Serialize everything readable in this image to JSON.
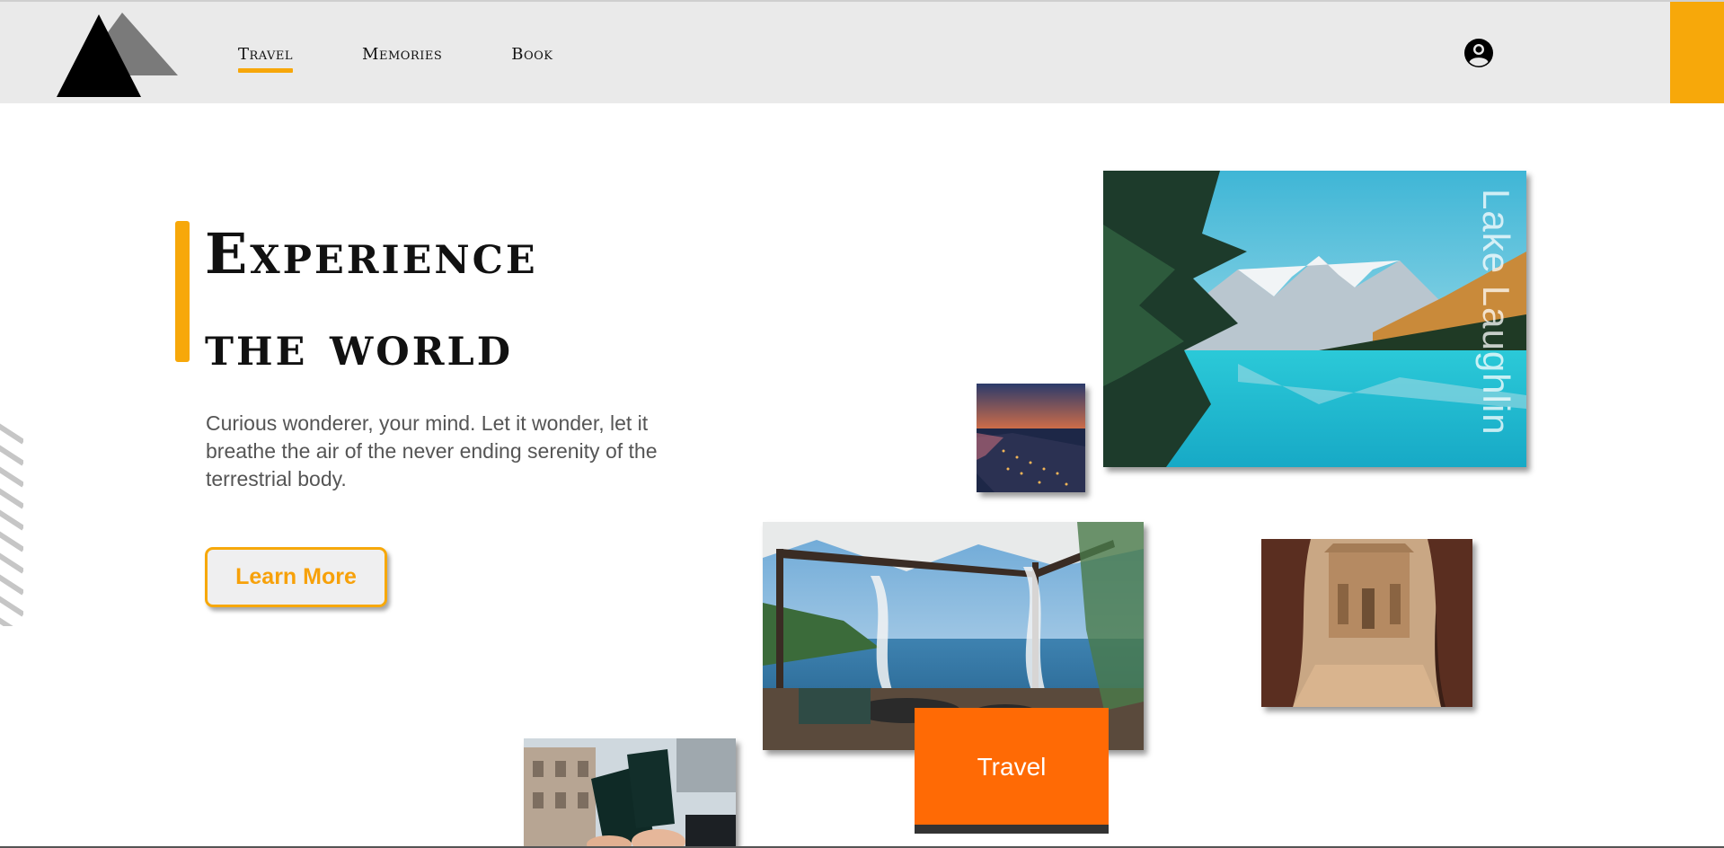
{
  "nav": {
    "items": [
      {
        "label": "Travel",
        "active": true
      },
      {
        "label": "Memories",
        "active": false
      },
      {
        "label": "Book",
        "active": false
      }
    ]
  },
  "icons": {
    "logo": "mountain-logo-icon",
    "account": "account-circle-icon"
  },
  "hero": {
    "title_line1": "Experience",
    "title_line2": "the world",
    "description": "Curious wonderer, your mind. Let it wonder, let it breathe the air of the never ending serenity of the terrestrial body.",
    "cta_label": "Learn More"
  },
  "gallery": {
    "lake_caption": "Lake Laughlin",
    "card_label": "Travel"
  },
  "colors": {
    "accent": "#f7a80a",
    "card": "#ff6a05",
    "header_bg": "#eaeaea",
    "text": "#111111"
  }
}
